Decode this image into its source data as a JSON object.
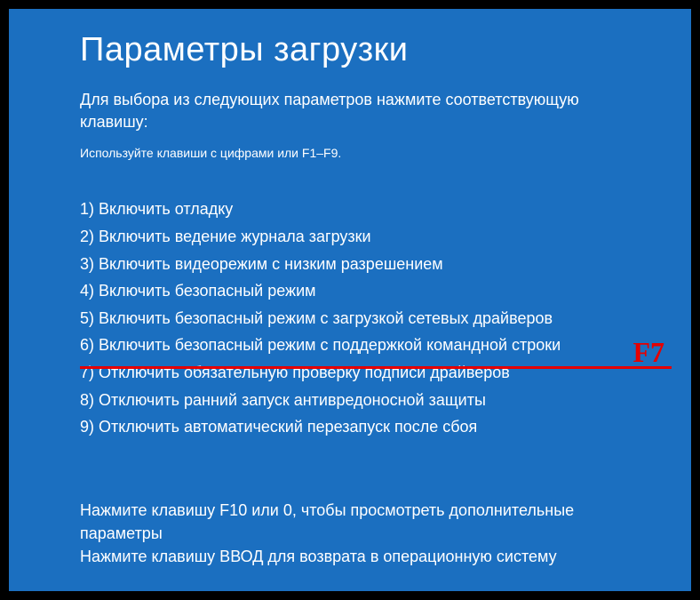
{
  "title": "Параметры загрузки",
  "intro": "Для выбора из следующих параметров нажмите соответствующую клавишу:",
  "hint": "Используйте клавиши с цифрами или F1–F9.",
  "options": [
    "1) Включить отладку",
    "2) Включить ведение журнала загрузки",
    "3) Включить видеорежим с низким разрешением",
    "4) Включить безопасный режим",
    "5) Включить безопасный режим с загрузкой сетевых драйверов",
    "6) Включить безопасный режим с поддержкой командной строки",
    "7) Отключить обязательную проверку подписи драйверов",
    "8) Отключить ранний запуск антивредоносной защиты",
    "9) Отключить автоматический перезапуск после сбоя"
  ],
  "footer_line1": "Нажмите клавишу F10 или 0, чтобы просмотреть дополнительные параметры",
  "footer_line2": "Нажмите клавишу ВВОД для возврата в операционную систему",
  "annotation": {
    "label": "F7",
    "color": "#e60000"
  }
}
